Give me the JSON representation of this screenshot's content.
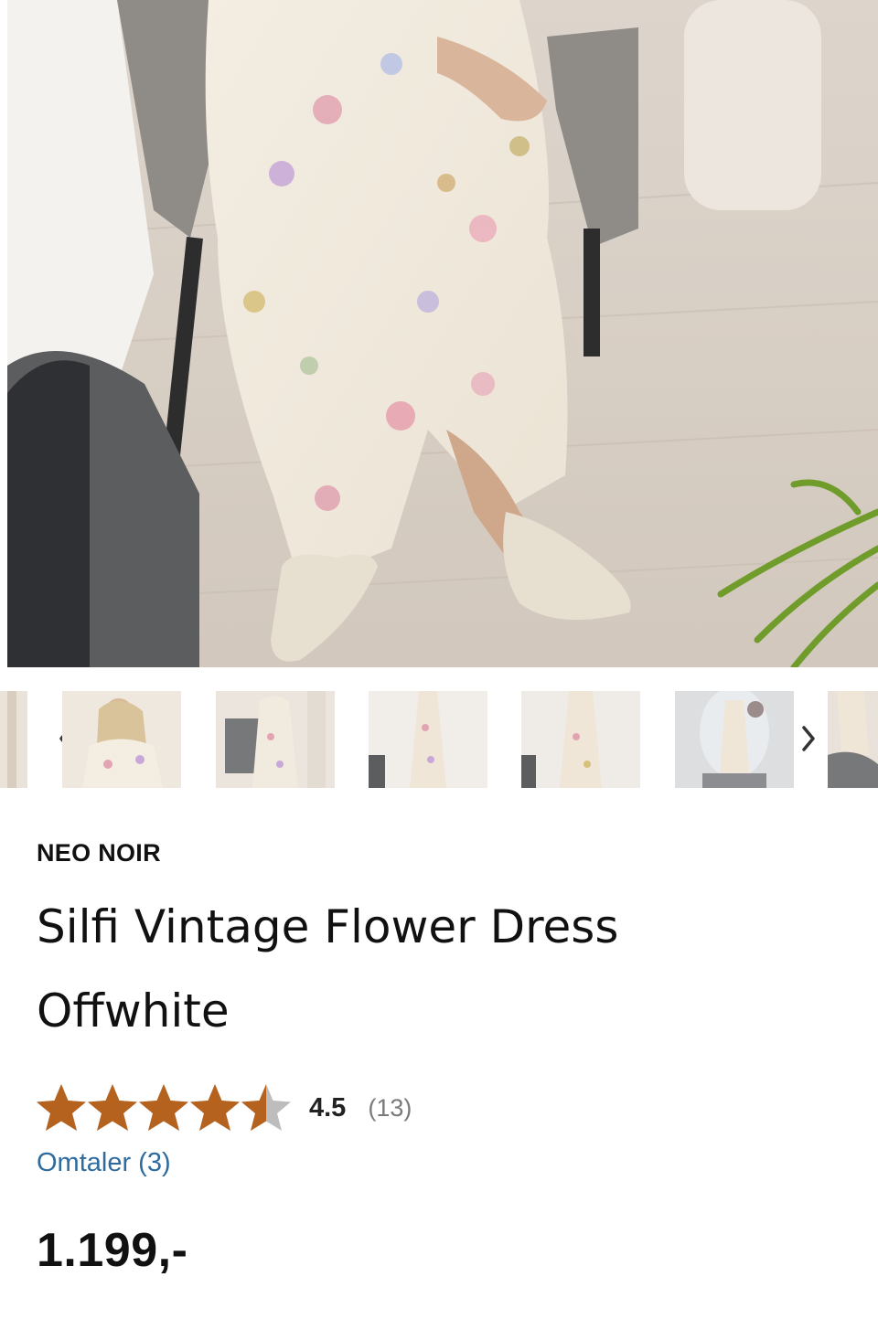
{
  "product": {
    "brand": "NEO NOIR",
    "title": "Silfi Vintage Flower Dress Offwhite",
    "rating": {
      "value": 4.5,
      "value_label": "4.5",
      "count_label": "(13)",
      "max": 5,
      "star_color": "#B5621E",
      "empty_star_color": "#BDBDBD"
    },
    "reviews_link": "Omtaler (3)",
    "price": "1.199,-"
  },
  "gallery": {
    "thumbnail_count": 7,
    "active_index": 1,
    "prev_icon": "chevron-left-icon",
    "next_icon": "chevron-right-icon"
  },
  "colors": {
    "link": "#2E6B9E",
    "text": "#111111"
  }
}
